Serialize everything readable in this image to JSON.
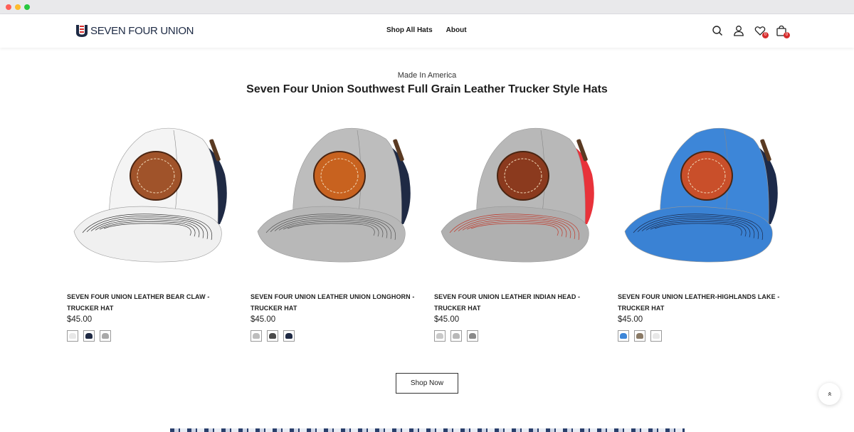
{
  "brand": {
    "name": "SEVEN FOUR UNION"
  },
  "nav": {
    "items": [
      "Shop All Hats",
      "About"
    ]
  },
  "header_icons": {
    "search": "search-icon",
    "account": "user-icon",
    "wishlist": "heart-icon",
    "wishlist_count": "0",
    "cart": "bag-icon",
    "cart_count": "0"
  },
  "section": {
    "kicker": "Made In America",
    "title": "Seven Four Union Southwest Full Grain Leather Trucker Style Hats"
  },
  "products": [
    {
      "name": "SEVEN FOUR UNION LEATHER BEAR CLAW - TRUCKER HAT",
      "price": "$45.00",
      "patch": "bear-claw",
      "colors": {
        "front": "#f4f4f4",
        "back": "#1f2a44",
        "brim": "#f0f0f0",
        "stitch": "#333333",
        "patch": "#a0532a"
      },
      "swatches": [
        "#e8e8e8",
        "#1f2a44",
        "#a9a9a9"
      ]
    },
    {
      "name": "SEVEN FOUR UNION LEATHER UNION LONGHORN - TRUCKER HAT",
      "price": "$45.00",
      "patch": "longhorn",
      "colors": {
        "front": "#bdbdbd",
        "back": "#1f2a44",
        "brim": "#b8b8b8",
        "stitch": "#555555",
        "patch": "#c8621f"
      },
      "swatches": [
        "#bdbdbd",
        "#4a4a4a",
        "#1f2a44"
      ]
    },
    {
      "name": "SEVEN FOUR UNION LEATHER INDIAN HEAD - TRUCKER HAT",
      "price": "$45.00",
      "patch": "indian-head",
      "colors": {
        "front": "#b8b8b8",
        "back": "#e8323a",
        "brim": "#b0b0b0",
        "stitch": "#c0392b",
        "patch": "#8b3a1e"
      },
      "swatches": [
        "#c9c9c9",
        "#b8b8b8",
        "#8a8a8a"
      ]
    },
    {
      "name": "SEVEN FOUR UNION LEATHER-HIGHLANDS LAKE - TRUCKER HAT",
      "price": "$45.00",
      "patch": "highlands-lake",
      "colors": {
        "front": "#3d86d8",
        "back": "#1c2a4a",
        "brim": "#3a82d4",
        "stitch": "#1c2a4a",
        "patch": "#c94f2a"
      },
      "swatches": [
        "#3d86d8",
        "#8a7a66",
        "#e8e8e8"
      ]
    }
  ],
  "cta": {
    "label": "Shop Now"
  },
  "back_to_top": {
    "icon": "chevron-double-up-icon",
    "glyph": "»"
  }
}
